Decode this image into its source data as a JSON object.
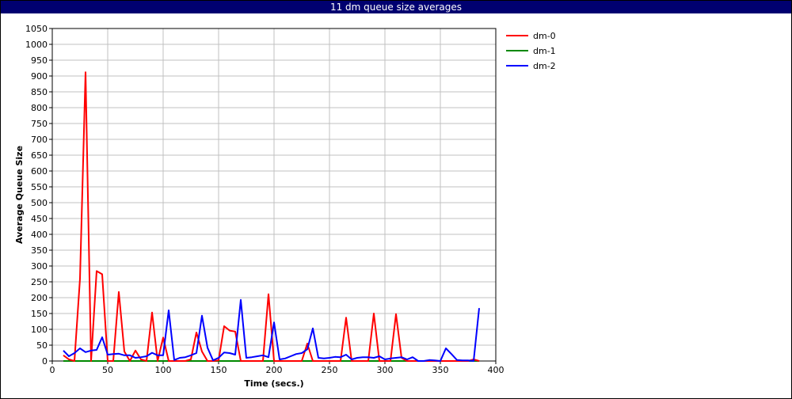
{
  "window": {
    "title": "11 dm queue size averages"
  },
  "chart_data": {
    "type": "line",
    "title": "11 dm queue size averages",
    "xlabel": "Time (secs.)",
    "ylabel": "Average Queue Size",
    "xlim": [
      0,
      400
    ],
    "ylim": [
      0,
      1050
    ],
    "xticks": [
      0,
      50,
      100,
      150,
      200,
      250,
      300,
      350,
      400
    ],
    "yticks": [
      0,
      50,
      100,
      150,
      200,
      250,
      300,
      350,
      400,
      450,
      500,
      550,
      600,
      650,
      700,
      750,
      800,
      850,
      900,
      950,
      1000,
      1050
    ],
    "grid": true,
    "legend": "top-right",
    "series": [
      {
        "name": "dm-0",
        "color": "#ff0000",
        "x": [
          10,
          15,
          20,
          25,
          30,
          35,
          40,
          45,
          50,
          55,
          60,
          65,
          70,
          75,
          80,
          85,
          90,
          95,
          100,
          105,
          110,
          115,
          120,
          125,
          130,
          135,
          140,
          145,
          150,
          155,
          160,
          165,
          170,
          175,
          180,
          185,
          190,
          195,
          200,
          205,
          210,
          215,
          220,
          225,
          230,
          235,
          240,
          245,
          250,
          255,
          260,
          265,
          270,
          275,
          280,
          285,
          290,
          295,
          300,
          305,
          310,
          315,
          320,
          325,
          330,
          335,
          340,
          345,
          350,
          355,
          360,
          365,
          370,
          375,
          380,
          385
        ],
        "y": [
          18,
          5,
          0,
          260,
          912,
          0,
          284,
          274,
          0,
          0,
          218,
          30,
          0,
          33,
          5,
          0,
          153,
          0,
          74,
          0,
          0,
          0,
          0,
          5,
          90,
          30,
          0,
          0,
          2,
          110,
          96,
          93,
          0,
          0,
          0,
          0,
          0,
          211,
          0,
          0,
          0,
          0,
          0,
          0,
          55,
          0,
          0,
          0,
          0,
          0,
          0,
          137,
          0,
          0,
          0,
          0,
          150,
          0,
          0,
          0,
          148,
          10,
          0,
          0,
          0,
          0,
          0,
          0,
          0,
          0,
          0,
          0,
          0,
          0,
          5,
          0
        ]
      },
      {
        "name": "dm-1",
        "color": "#008800",
        "x": [
          10,
          385
        ],
        "y": [
          0,
          0
        ]
      },
      {
        "name": "dm-2",
        "color": "#0000ff",
        "x": [
          10,
          15,
          20,
          25,
          30,
          35,
          40,
          45,
          50,
          55,
          60,
          65,
          70,
          75,
          80,
          85,
          90,
          95,
          100,
          105,
          110,
          115,
          120,
          125,
          130,
          135,
          140,
          145,
          150,
          155,
          160,
          165,
          170,
          175,
          180,
          185,
          190,
          195,
          200,
          205,
          210,
          215,
          220,
          225,
          230,
          235,
          240,
          245,
          250,
          255,
          260,
          265,
          270,
          275,
          280,
          285,
          290,
          295,
          300,
          305,
          310,
          315,
          320,
          325,
          330,
          335,
          340,
          345,
          350,
          355,
          360,
          365,
          370,
          375,
          380,
          385
        ],
        "y": [
          33,
          15,
          25,
          40,
          28,
          33,
          35,
          75,
          20,
          22,
          23,
          18,
          18,
          10,
          12,
          15,
          26,
          18,
          18,
          160,
          3,
          10,
          12,
          18,
          25,
          143,
          42,
          2,
          10,
          27,
          25,
          20,
          193,
          10,
          12,
          15,
          18,
          12,
          122,
          5,
          8,
          15,
          22,
          25,
          37,
          103,
          10,
          8,
          10,
          13,
          12,
          20,
          5,
          10,
          12,
          12,
          10,
          15,
          5,
          8,
          10,
          12,
          5,
          12,
          0,
          0,
          3,
          2,
          0,
          40,
          22,
          3,
          2,
          2,
          0,
          167
        ]
      }
    ]
  }
}
